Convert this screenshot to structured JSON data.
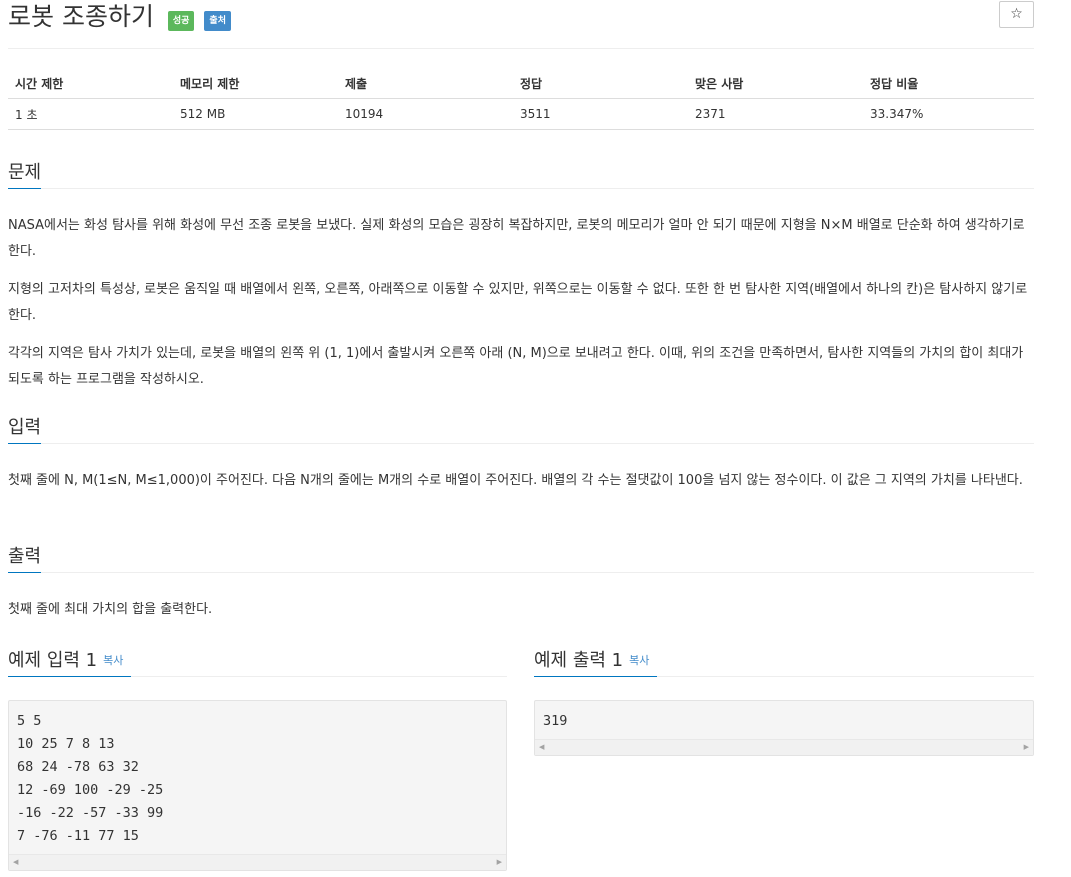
{
  "problem": {
    "title": "로봇 조종하기",
    "badges": {
      "success": "성공",
      "source": "출처"
    },
    "star_glyph": "☆"
  },
  "info_table": {
    "headers": [
      "시간 제한",
      "메모리 제한",
      "제출",
      "정답",
      "맞은 사람",
      "정답 비율"
    ],
    "values": [
      "1 초",
      "512 MB",
      "10194",
      "3511",
      "2371",
      "33.347%"
    ]
  },
  "sections": {
    "description": {
      "heading": "문제",
      "paragraphs": [
        "NASA에서는 화성 탐사를 위해 화성에 무선 조종 로봇을 보냈다. 실제 화성의 모습은 굉장히 복잡하지만, 로봇의 메모리가 얼마 안 되기 때문에 지형을 N×M 배열로 단순화 하여 생각하기로 한다.",
        "지형의 고저차의 특성상, 로봇은 움직일 때 배열에서 왼쪽, 오른쪽, 아래쪽으로 이동할 수 있지만, 위쪽으로는 이동할 수 없다. 또한 한 번 탐사한 지역(배열에서 하나의 칸)은 탐사하지 않기로 한다.",
        "각각의 지역은 탐사 가치가 있는데, 로봇을 배열의 왼쪽 위 (1, 1)에서 출발시켜 오른쪽 아래 (N, M)으로 보내려고 한다. 이때, 위의 조건을 만족하면서, 탐사한 지역들의 가치의 합이 최대가 되도록 하는 프로그램을 작성하시오."
      ]
    },
    "input": {
      "heading": "입력",
      "paragraphs": [
        "첫째 줄에 N, M(1≤N, M≤1,000)이 주어진다. 다음 N개의 줄에는 M개의 수로 배열이 주어진다. 배열의 각 수는 절댓값이 100을 넘지 않는 정수이다. 이 값은 그 지역의 가치를 나타낸다."
      ]
    },
    "output": {
      "heading": "출력",
      "paragraphs": [
        "첫째 줄에 최대 가치의 합을 출력한다."
      ]
    }
  },
  "samples": {
    "input": {
      "heading": "예제 입력 1",
      "copy_label": "복사",
      "content": "5 5\n10 25 7 8 13\n68 24 -78 63 32\n12 -69 100 -29 -25\n-16 -22 -57 -33 99\n7 -76 -11 77 15"
    },
    "output": {
      "heading": "예제 출력 1",
      "copy_label": "복사",
      "content": "319"
    }
  },
  "colors": {
    "badge_success": "#5cb85c",
    "badge_source": "#428bca",
    "heading_underline": "#0076c0",
    "link": "#428bca"
  }
}
